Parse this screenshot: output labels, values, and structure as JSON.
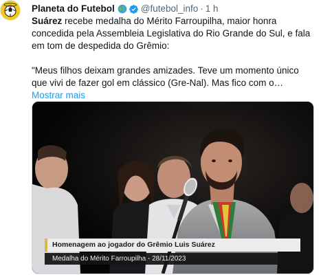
{
  "tweet": {
    "author": {
      "display_name": "Planeta do Futebol",
      "name_emoji_icon": "globe-icon",
      "verified_icon": "verified-badge-icon",
      "handle": "@futebol_info",
      "separator": "·",
      "time": "1 h"
    },
    "text": {
      "lead_bold": "Suárez",
      "lead_rest": " recebe medalha do Mérito Farroupilha, maior honra concedida pela Assembleia Legislativa do Rio Grande do Sul, e fala em tom de despedida do Grêmio:",
      "quote": "\"Meus filhos deixam grandes amizades. Teve um momento único que vivi de fazer gol em clássico (Gre-Nal). Mas fico com o…"
    },
    "show_more": "Mostrar mais",
    "media": {
      "caption_title": "Homenagem ao jogador do Grêmio Luis Suárez",
      "caption_subtitle": "Medalha do Mérito Farroupilha - 28/11/2023"
    }
  },
  "colors": {
    "text_primary": "#0f1419",
    "text_secondary": "#536471",
    "link": "#1d9bf0",
    "verified": "#1d9bf0",
    "caption_accent": "#d8b84a"
  }
}
